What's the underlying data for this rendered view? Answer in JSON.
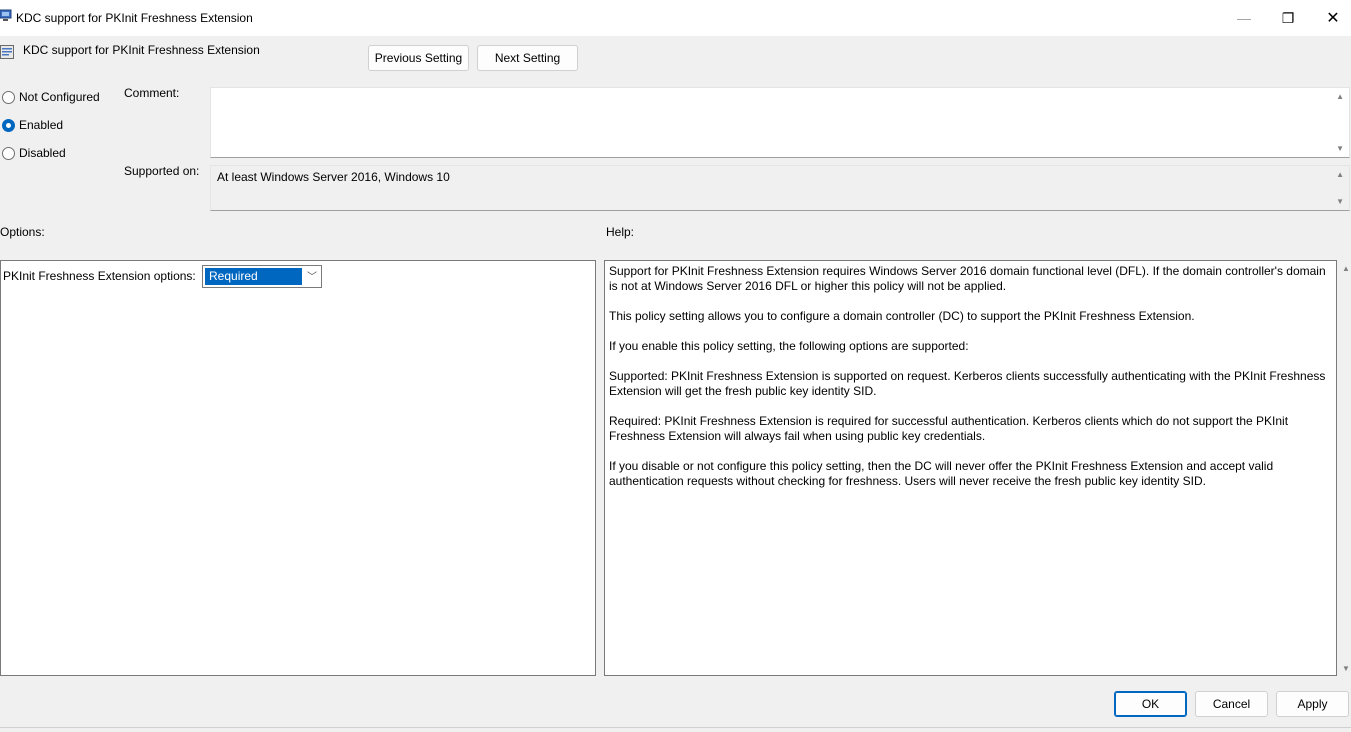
{
  "window": {
    "title": "KDC support for PKInit Freshness Extension",
    "controls": {
      "minimize": "—",
      "maximize": "❐",
      "close": "✕"
    }
  },
  "header": {
    "policy_name": "KDC support for PKInit Freshness Extension",
    "previous_label": "Previous Setting",
    "next_label": "Next Setting"
  },
  "state": {
    "options": [
      {
        "label": "Not Configured",
        "checked": false
      },
      {
        "label": "Enabled",
        "checked": true
      },
      {
        "label": "Disabled",
        "checked": false
      }
    ]
  },
  "comment": {
    "label": "Comment:",
    "value": ""
  },
  "supported": {
    "label": "Supported on:",
    "value": "At least Windows Server 2016, Windows 10"
  },
  "options_panel": {
    "title": "Options:",
    "pkinit_label": "PKInit Freshness Extension options:",
    "pkinit_selected": "Required"
  },
  "help_panel": {
    "title": "Help:",
    "paragraphs": [
      "Support for PKInit Freshness Extension requires Windows Server 2016 domain functional level (DFL). If the domain controller's domain is not at Windows Server 2016 DFL or higher this policy will not be applied.",
      "This policy setting allows you to configure a domain controller (DC) to support the PKInit Freshness Extension.",
      "If you enable this policy setting, the following options are supported:",
      "Supported: PKInit Freshness Extension is supported on request. Kerberos clients successfully authenticating with the PKInit Freshness Extension will get the fresh public key identity SID.",
      "Required: PKInit Freshness Extension is required for successful authentication. Kerberos clients which do not support the PKInit Freshness Extension will always fail when using public key credentials.",
      "If you disable or not configure this policy setting, then the DC will never offer the PKInit Freshness Extension and  accept valid authentication requests without checking for freshness. Users will never receive the fresh public key identity SID."
    ]
  },
  "footer": {
    "ok_label": "OK",
    "cancel_label": "Cancel",
    "apply_label": "Apply"
  },
  "colors": {
    "accent": "#0067c0",
    "background": "#f0f0f0"
  }
}
